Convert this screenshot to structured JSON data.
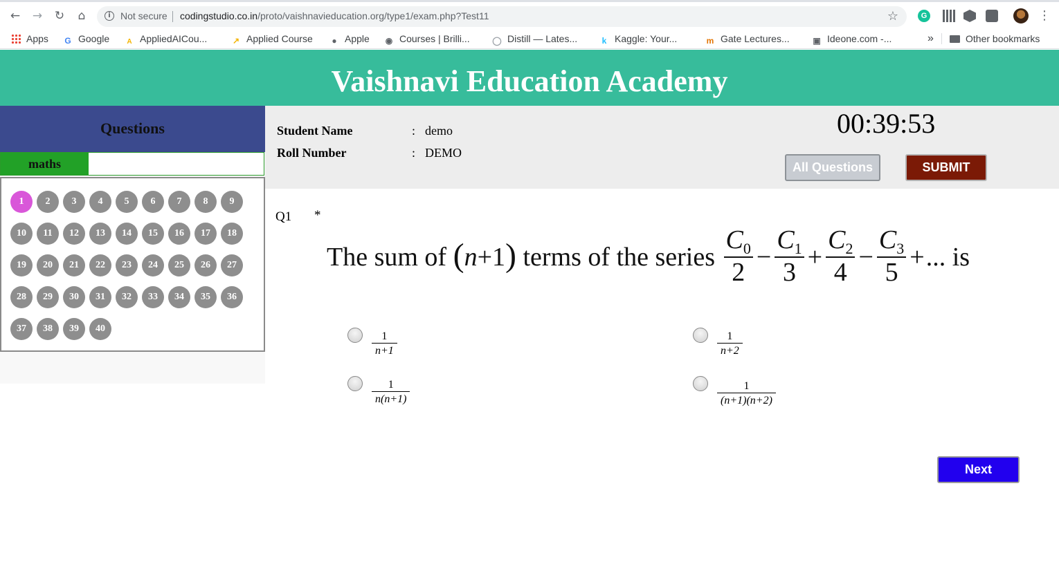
{
  "browser": {
    "security_label": "Not secure",
    "url_host": "codingstudio.co.in",
    "url_path": "/proto/vaishnavieducation.org/type1/exam.php?Test11",
    "extension_g_letter": "G",
    "bookmarks": [
      {
        "label": "Apps",
        "icon": "apps-icon"
      },
      {
        "label": "Google",
        "icon": "google-icon"
      },
      {
        "label": "AppliedAICou...",
        "icon": "appliedai-icon"
      },
      {
        "label": "Applied Course",
        "icon": "bookmark-arrow-icon"
      },
      {
        "label": "Apple",
        "icon": "apple-icon"
      },
      {
        "label": "Courses | Brilli...",
        "icon": "brilliant-icon"
      },
      {
        "label": "Distill — Lates...",
        "icon": "distill-icon"
      },
      {
        "label": "Kaggle: Your...",
        "icon": "kaggle-icon"
      },
      {
        "label": "Gate Lectures...",
        "icon": "gate-icon"
      },
      {
        "label": "Ideone.com -...",
        "icon": "ideone-icon"
      }
    ],
    "bookmarks_overflow": "»",
    "other_bookmarks": "Other bookmarks",
    "bookmark_glyphs": {
      "google": "G",
      "appliedai": "A",
      "applied_course": "↗",
      "apple": "●",
      "brilliant": "◉",
      "distill": "◯",
      "kaggle": "k",
      "gate": "m",
      "ideone": "▣"
    }
  },
  "header": {
    "title": "Vaishnavi Education Academy"
  },
  "sidebar": {
    "title": "Questions",
    "subject_tab": "maths",
    "question_numbers": [
      "1",
      "2",
      "3",
      "4",
      "5",
      "6",
      "7",
      "8",
      "9",
      "10",
      "11",
      "12",
      "13",
      "14",
      "15",
      "16",
      "17",
      "18",
      "19",
      "20",
      "21",
      "22",
      "23",
      "24",
      "25",
      "26",
      "27",
      "28",
      "29",
      "30",
      "31",
      "32",
      "33",
      "34",
      "35",
      "36",
      "37",
      "38",
      "39",
      "40"
    ],
    "active_question": "1"
  },
  "student": {
    "name_label": "Student Name",
    "name_value": "demo",
    "roll_label": "Roll Number",
    "roll_value": "DEMO",
    "separator": ":"
  },
  "timer": "00:39:53",
  "actions": {
    "all_questions": "All Questions",
    "submit": "SUBMIT",
    "next": "Next"
  },
  "question": {
    "number": "Q1",
    "marker": "*",
    "text_prefix": "The sum of",
    "paren_open": "(",
    "paren_close": ")",
    "n_var": "n",
    "plus_one": "+1",
    "text_mid": "terms of the series",
    "series": [
      {
        "c": "C",
        "sub": "0",
        "den": "2"
      },
      {
        "c": "C",
        "sub": "1",
        "den": "3"
      },
      {
        "c": "C",
        "sub": "2",
        "den": "4"
      },
      {
        "c": "C",
        "sub": "3",
        "den": "5"
      }
    ],
    "operators": [
      "−",
      "+",
      "−",
      "+"
    ],
    "text_suffix": "... is"
  },
  "options": [
    {
      "num": "1",
      "den": "n+1"
    },
    {
      "num": "1",
      "den": "n+2"
    },
    {
      "num": "1",
      "den": "n(n+1)"
    },
    {
      "num": "1",
      "den": "(n+1)(n+2)"
    }
  ],
  "colors": {
    "header_bg": "#37bc9b",
    "sidebar_head_bg": "#3b4a8e",
    "tab_active_bg": "#22a127",
    "question_bubble": "#8e8e8e",
    "question_bubble_active": "#d957d9",
    "submit_bg": "#7b1a06",
    "next_bg": "#2200ee"
  }
}
